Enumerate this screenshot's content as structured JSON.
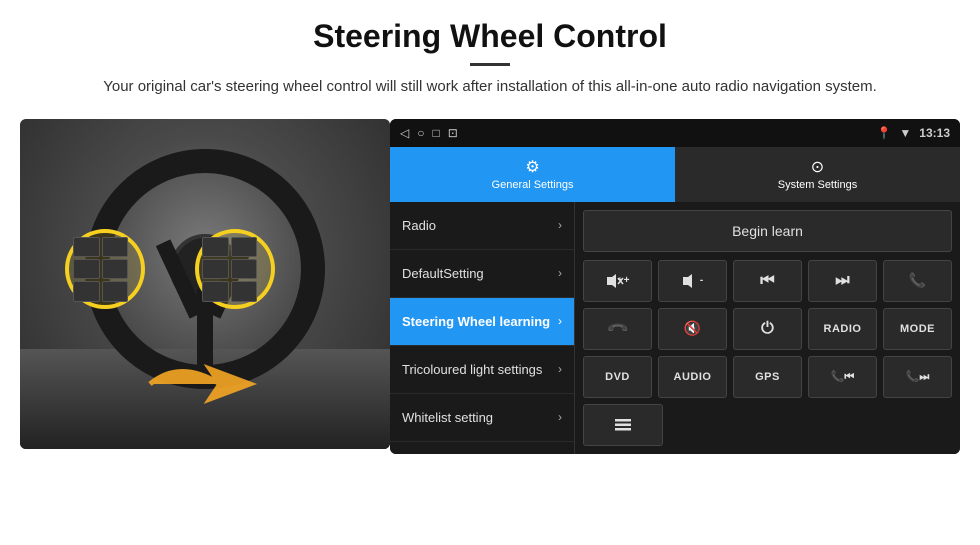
{
  "header": {
    "title": "Steering Wheel Control",
    "subtitle": "Your original car's steering wheel control will still work after installation of this all-in-one auto radio navigation system."
  },
  "statusBar": {
    "time": "13:13",
    "icons": [
      "◁",
      "○",
      "□",
      "⊡"
    ]
  },
  "tabs": [
    {
      "id": "general",
      "label": "General Settings",
      "icon": "⚙",
      "active": true
    },
    {
      "id": "system",
      "label": "System Settings",
      "icon": "⊙",
      "active": false
    }
  ],
  "menuItems": [
    {
      "id": "radio",
      "label": "Radio",
      "active": false
    },
    {
      "id": "default",
      "label": "DefaultSetting",
      "active": false
    },
    {
      "id": "steering",
      "label": "Steering Wheel learning",
      "active": true
    },
    {
      "id": "tricoloured",
      "label": "Tricoloured light settings",
      "active": false
    },
    {
      "id": "whitelist",
      "label": "Whitelist setting",
      "active": false
    }
  ],
  "controlPanel": {
    "beginLearnLabel": "Begin learn",
    "row1": [
      {
        "id": "vol-up",
        "text": "🔊+"
      },
      {
        "id": "vol-down",
        "text": "🔊-"
      },
      {
        "id": "prev",
        "text": "⏮"
      },
      {
        "id": "next",
        "text": "⏭"
      },
      {
        "id": "phone",
        "text": "📞"
      }
    ],
    "row2": [
      {
        "id": "hang-up",
        "text": "📞↓"
      },
      {
        "id": "mute",
        "text": "🔇×"
      },
      {
        "id": "power",
        "text": "⏻"
      },
      {
        "id": "radio-btn",
        "text": "RADIO"
      },
      {
        "id": "mode",
        "text": "MODE"
      }
    ],
    "row3": [
      {
        "id": "dvd",
        "text": "DVD"
      },
      {
        "id": "audio",
        "text": "AUDIO"
      },
      {
        "id": "gps",
        "text": "GPS"
      },
      {
        "id": "tel-prev",
        "text": "📞⏮"
      },
      {
        "id": "tel-next",
        "text": "📞⏭"
      }
    ],
    "row4": [
      {
        "id": "list",
        "text": "≡"
      }
    ]
  }
}
